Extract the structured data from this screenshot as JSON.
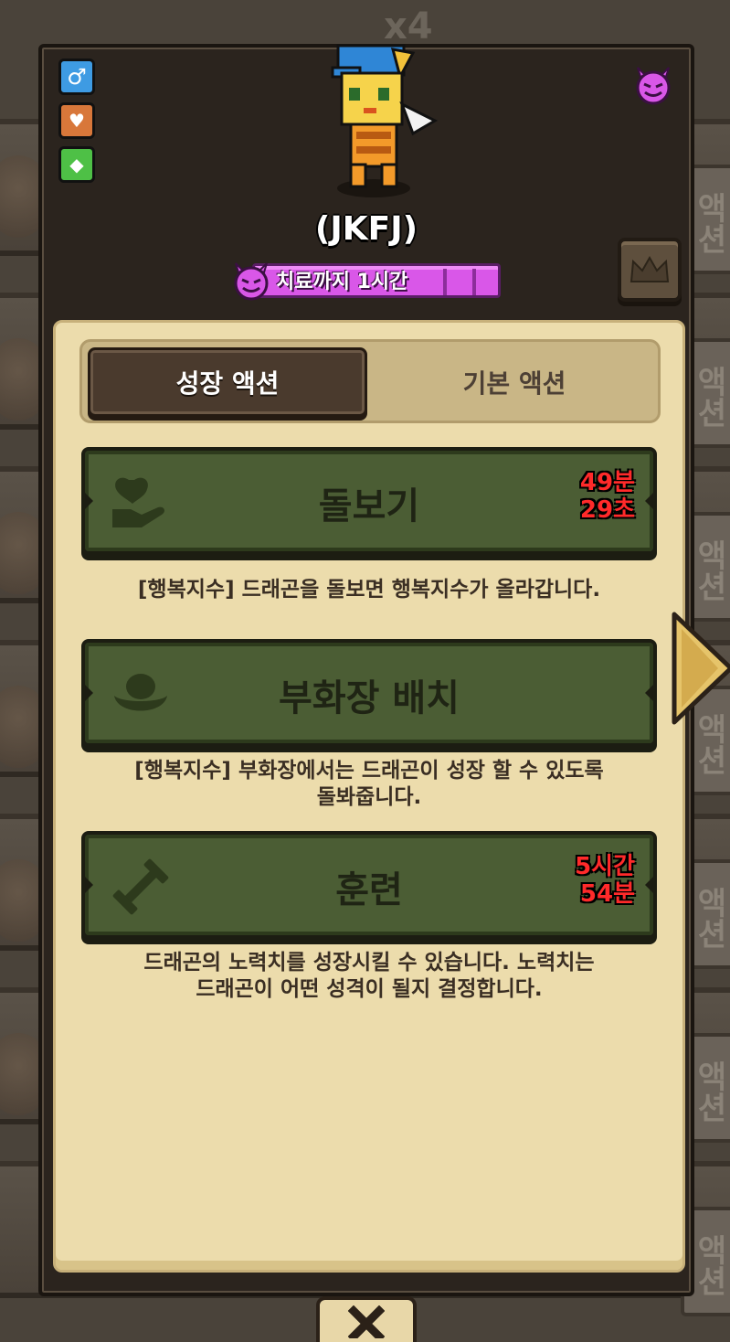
{
  "background": {
    "count_label": "x4",
    "action_label": "액션"
  },
  "dragon": {
    "name": "(JKFJ)",
    "status_text": "치료까지 1시간",
    "status_color": "#d957e8"
  },
  "stat_icons": [
    "male-icon",
    "heart-icon",
    "gem-icon"
  ],
  "tabs": {
    "active_label": "성장 액션",
    "inactive_label": "기본 액션"
  },
  "actions": [
    {
      "label": "돌보기",
      "icon": "hand-heart-icon",
      "timer_line1": "49분",
      "timer_line2": "29초",
      "description": "[행복지수] 드래곤을 돌보면 행복지수가 올라갑니다."
    },
    {
      "label": "부화장 배치",
      "icon": "nest-icon",
      "timer_line1": "",
      "timer_line2": "",
      "description_line1": "[행복지수] 부화장에서는 드래곤이 성장 할 수 있도록",
      "description_line2": "돌봐줍니다."
    },
    {
      "label": "훈련",
      "icon": "dumbbell-icon",
      "timer_line1": "5시간",
      "timer_line2": "54분",
      "description_line1": "드래곤의 노력치를 성장시킬 수 있습니다. 노력치는",
      "description_line2": "드래곤이 어떤 성격이 될지 결정합니다."
    }
  ],
  "colors": {
    "accent_red": "#ff2a2a",
    "button_green": "#4b5d34",
    "parchment": "#ecdcac"
  }
}
